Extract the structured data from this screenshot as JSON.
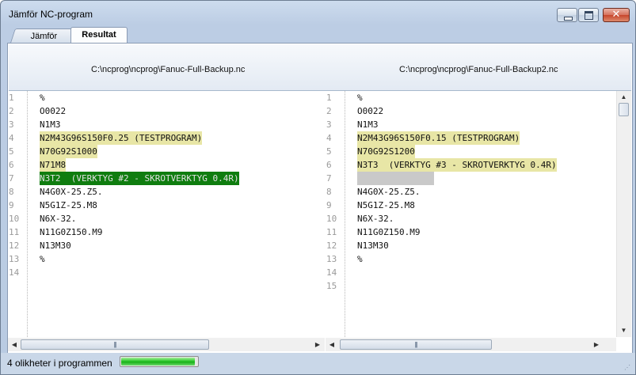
{
  "window": {
    "title": "Jämför NC-program"
  },
  "tabs": [
    {
      "label": "Jämför"
    },
    {
      "label": "Resultat"
    }
  ],
  "header": {
    "left_path": "C:\\ncprog\\ncprog\\Fanuc-Full-Backup.nc",
    "right_path": "C:\\ncprog\\ncprog\\Fanuc-Full-Backup2.nc"
  },
  "left": {
    "line_numbers": [
      "1",
      "2",
      "3",
      "4",
      "5",
      "6",
      "7",
      "8",
      "9",
      "10",
      "11",
      "12",
      "13",
      "14"
    ],
    "lines": [
      "%",
      "O0022",
      "N1M3",
      "N2M43G96S150F0.25 (TESTPROGRAM)",
      "N70G92S1000",
      "N71M8",
      "N3T2  (VERKTYG #2 - SKROTVERKTYG 0.4R)",
      "N4G0X-25.Z5.",
      "N5G1Z-25.M8",
      "N6X-32.",
      "N11G0Z150.M9",
      "N13M30",
      "%"
    ]
  },
  "right": {
    "line_numbers": [
      "1",
      "2",
      "3",
      "4",
      "5",
      "6",
      "7",
      "8",
      "9",
      "10",
      "11",
      "12",
      "13",
      "14",
      "15"
    ],
    "lines": [
      "%",
      "O0022",
      "N1M3",
      "N2M43G96S150F0.15 (TESTPROGRAM)",
      "N70G92S1200",
      "N3T3  (VERKTYG #3 - SKROTVERKTYG 0.4R)",
      "",
      "N4G0X-25.Z5.",
      "N5G1Z-25.M8",
      "N6X-32.",
      "N11G0Z150.M9",
      "N13M30",
      "%"
    ]
  },
  "colors": {
    "changed": "#e8e6a6",
    "deleted": "#0f7d0f",
    "missing": "#c9c9c9"
  },
  "status": {
    "text": "4 olikheter i programmen",
    "progress": 0.97
  }
}
